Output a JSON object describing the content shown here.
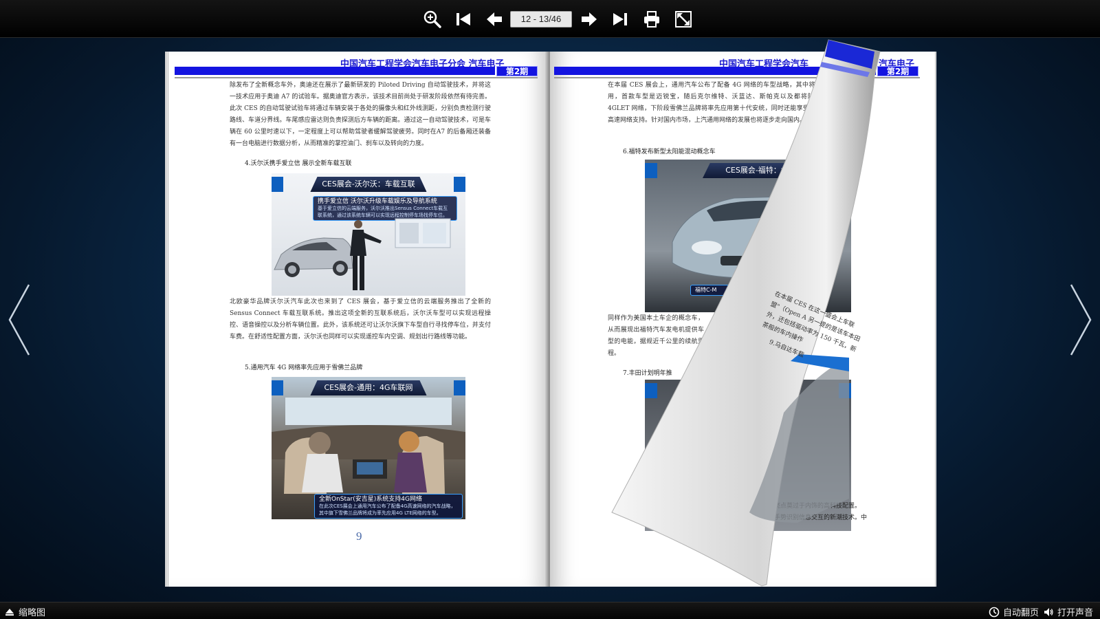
{
  "toolbar": {
    "page_indicator": "12 - 13/46",
    "buttons": {
      "zoom": "zoom-in-icon",
      "first": "first-page-icon",
      "prev": "previous-page-icon",
      "next": "next-page-icon",
      "last": "last-page-icon",
      "print": "print-icon",
      "fullscreen": "fullscreen-icon"
    }
  },
  "header": {
    "title_left": "中国汽车工程学会汽车电子分会 汽车电子",
    "title_right": "中国汽车工程学会汽车",
    "title_right_tail": "汽车电子",
    "issue": "第2期"
  },
  "left_page": {
    "para1": "除发布了全新概念车外，奥迪还在展示了最新研发的 Piloted Driving 自动驾驶技术，并将这一技术应用于奥迪 A7 的试验车。据奥迪官方表示，该技术目前尚处于研发阶段依然有待完善。此次 CES 的自动驾驶试验车将通过车辆安装于各处的摄像头和红外线测距，分别负责检测行驶路线、车道分界线。车尾感应雷达则负责探测后方车辆的距离。通过这一自动驾驶技术，可是车辆在 60 公里时速以下，一定程度上可以帮助驾驶者缓解驾驶疲劳。同时在A7 的后备厢还装备有一台电脑进行数据分析，从而精准的掌控油门、刹车以及转向的力度。",
    "heading4": "4.沃尔沃携手爱立信 展示全新车载互联",
    "fig1_banner": "CES展会-沃尔沃：车载互联",
    "fig1_caption_title": "携手爱立信 沃尔沃升级车载娱乐及导航系统",
    "fig1_caption_body": "基于爱立信的云端服务，沃尔沃推出Sensus Connect车载互联系统，通过该系统车辆可以实现远程控制停车场找停车位。",
    "para2": "北欧豪华品牌沃尔沃汽车此次也来到了 CES 展会，基于爱立信的云端服务推出了全新的 Sensus Connect 车载互联系统。推出这项全新的互联系统后，沃尔沃车型可以实现远程操控、语音操控以及分析车辆位置。此外，该系统还可让沃尔沃旗下车型自行寻找停车位，并支付车费。在舒适性配置方面，沃尔沃也同样可以实现遥控车内空调、规划出行路线等功能。",
    "heading5": "5.通用汽车 4G 网络率先应用于雪佛兰品牌",
    "fig2_banner": "CES展会-通用：4G车联网",
    "fig2_caption_title": "全新OnStar(安吉星)系统支持4G网络",
    "fig2_caption_body": "在此次CES展会上通用汽车公布了配备4G高速网络的汽车战略，其中旗下雪佛兰品牌将成为率先应用4G LTE网络的车型。",
    "page_number": "9"
  },
  "right_page": {
    "para1": "在本届 CES 展会上，通用汽车公布了配备 4G 网络的车型战略，其中将率先应用，首款车型是迈锐宝，随后克尔维特、沃蓝达、斯帕克以及都将陆续引入 4GLET 网络，下阶段雪佛兰品牌将率先应用第十代安统，同时还能享受 4G LTE 高速网络支持。针对国内市场，上汽通用网络的发展也将逐步走向国内。",
    "heading6": "6.福特发布新型太阳能混动概念车",
    "fig3_banner": "CES展会-福特：太阳能",
    "fig3_caption": "福特C-M",
    "para2": "同样作为美国本土车企的概念车，从而展现出福特汽车发电机提供车型的电能，据规近千公里的续航里程。",
    "heading7": "7.丰田计划明年推",
    "curl_text1": "在本届 CES 在这一盛会上车联盟\"（Open A 另一提的是该车本田外，还包括驱动率为 150 千瓦，新茶般的车内操作",
    "curl_text2": "9.马自达车载",
    "tail_text1": "亮点莫过于内饰的高科技配置。",
    "tail_text2": "手势识别信息交互的新潮技术。中"
  },
  "bottombar": {
    "thumbnail_label": "缩略图",
    "autoflip_label": "自动翻页",
    "sound_label": "打开声音"
  }
}
